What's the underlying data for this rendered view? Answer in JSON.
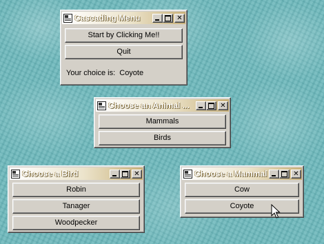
{
  "windows": {
    "cascading": {
      "title": "Cascading Menu",
      "start_button": "Start by Clicking Me!!",
      "quit_button": "Quit",
      "choice_label": "Your choice is:  Coyote"
    },
    "animal": {
      "title": "Choose an Animal ...",
      "buttons": [
        "Mammals",
        "Birds"
      ]
    },
    "bird": {
      "title": "Choose a Bird",
      "buttons": [
        "Robin",
        "Tanager",
        "Woodpecker"
      ]
    },
    "mammal": {
      "title": "Choose a Mammal",
      "buttons": [
        "Cow",
        "Coyote"
      ]
    }
  },
  "titlebar_buttons": {
    "minimize": "",
    "maximize": "",
    "close": "✕"
  },
  "colors": {
    "desktop": "#6fb9bc",
    "window_face": "#d4d0c8",
    "titlebar_end": "#c8b078"
  }
}
